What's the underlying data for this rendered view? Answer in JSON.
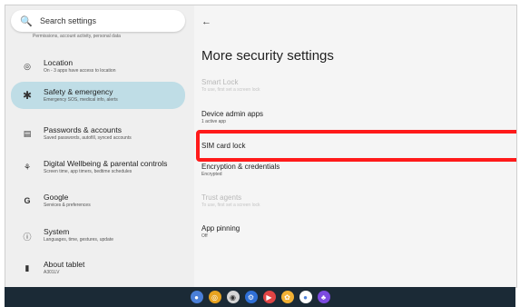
{
  "sidebar": {
    "search_placeholder": "Search settings",
    "partial_sub": "Permissions, account activity, personal data",
    "items": [
      {
        "title": "Location",
        "sub": "On - 3 apps have access to location",
        "icon": "location-icon"
      },
      {
        "title": "Safety & emergency",
        "sub": "Emergency SOS, medical info, alerts",
        "icon": "asterisk-icon",
        "active": true
      },
      {
        "title": "Passwords & accounts",
        "sub": "Saved passwords, autofill, synced accounts",
        "icon": "account-icon"
      },
      {
        "title": "Digital Wellbeing & parental controls",
        "sub": "Screen time, app timers, bedtime schedules",
        "icon": "wellbeing-icon"
      },
      {
        "title": "Google",
        "sub": "Services & preferences",
        "icon": "google-icon"
      },
      {
        "title": "System",
        "sub": "Languages, time, gestures, update",
        "icon": "info-icon"
      },
      {
        "title": "About tablet",
        "sub": "A301LV",
        "icon": "tablet-icon"
      }
    ]
  },
  "main": {
    "title": "More security settings",
    "rows": [
      {
        "title": "Smart Lock",
        "sub": "To use, first set a screen lock",
        "disabled": true
      },
      {
        "title": "Device admin apps",
        "sub": "1 active app",
        "disabled": false
      },
      {
        "title": "SIM card lock",
        "sub": "",
        "disabled": false
      },
      {
        "title": "Encryption & credentials",
        "sub": "Encrypted",
        "disabled": false
      },
      {
        "title": "Trust agents",
        "sub": "To use, first set a screen lock",
        "disabled": true
      },
      {
        "title": "App pinning",
        "sub": "Off",
        "disabled": false
      }
    ]
  },
  "colors": {
    "highlight": "#ff1a1a",
    "active_bg": "#bfdde6",
    "taskbar": "#1b2a36"
  },
  "taskbar": {
    "apps": [
      "launcher-icon",
      "chrome-icon",
      "camera-icon",
      "settings-icon",
      "play-store-icon",
      "photos-icon",
      "assistant-icon",
      "games-icon"
    ]
  }
}
